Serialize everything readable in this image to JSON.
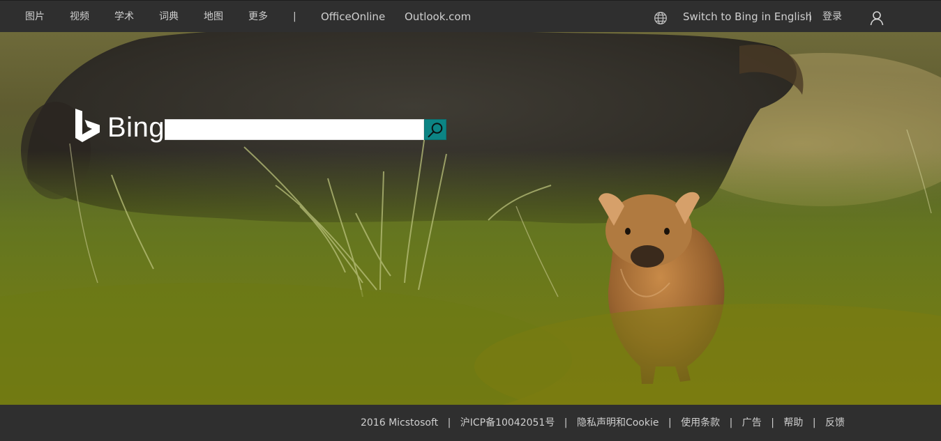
{
  "header": {
    "nav_left": [
      {
        "label": "图片"
      },
      {
        "label": "视频"
      },
      {
        "label": "学术"
      },
      {
        "label": "词典"
      },
      {
        "label": "地图"
      },
      {
        "label": "更多"
      }
    ],
    "separator": "|",
    "nav_apps": [
      {
        "label": "OfficeOnline"
      },
      {
        "label": "Outlook.com"
      }
    ],
    "globe_icon": "globe-icon",
    "switch_language": "Switch to Bing in English",
    "login": "登录",
    "user_icon": "user-icon"
  },
  "logo": {
    "wordmark": "Bing"
  },
  "search": {
    "value": "",
    "placeholder": "",
    "button_icon": "search-icon",
    "button_color": "#0c8484"
  },
  "footer": {
    "copyright": "2016 Micstosoft",
    "icp": "沪ICP备10042051号",
    "privacy": "隐私声明和Cookie",
    "terms": "使用条款",
    "ads": "广告",
    "help": "帮助",
    "feedback": "反馈",
    "separator": "|"
  },
  "colors": {
    "bar_background": "#2f2f2f",
    "bar_text": "#cfcfcf",
    "accent": "#0c8484"
  }
}
